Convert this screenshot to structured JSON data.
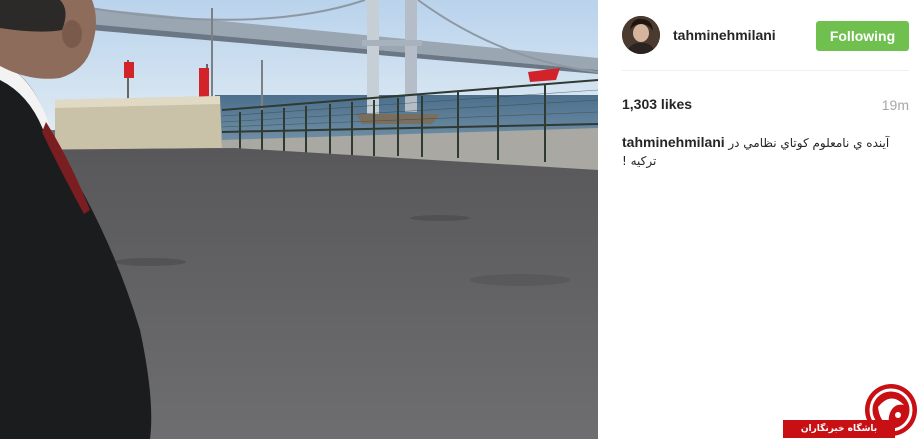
{
  "post": {
    "username": "tahminehmilani",
    "follow_button_label": "Following",
    "likes": "1,303 likes",
    "time_ago": "19m",
    "caption_user": "tahminehmilani",
    "caption_text": "آينده ي نامعلوم كوتاي نظامي در تركيه !"
  },
  "colors": {
    "follow_button": "#70c050",
    "watermark": "#c81014"
  },
  "icons": {
    "avatar": "profile-photo",
    "watermark_logo": "red-globe-logo"
  },
  "watermark": {
    "text": "باشگاه خبرنگاران"
  }
}
